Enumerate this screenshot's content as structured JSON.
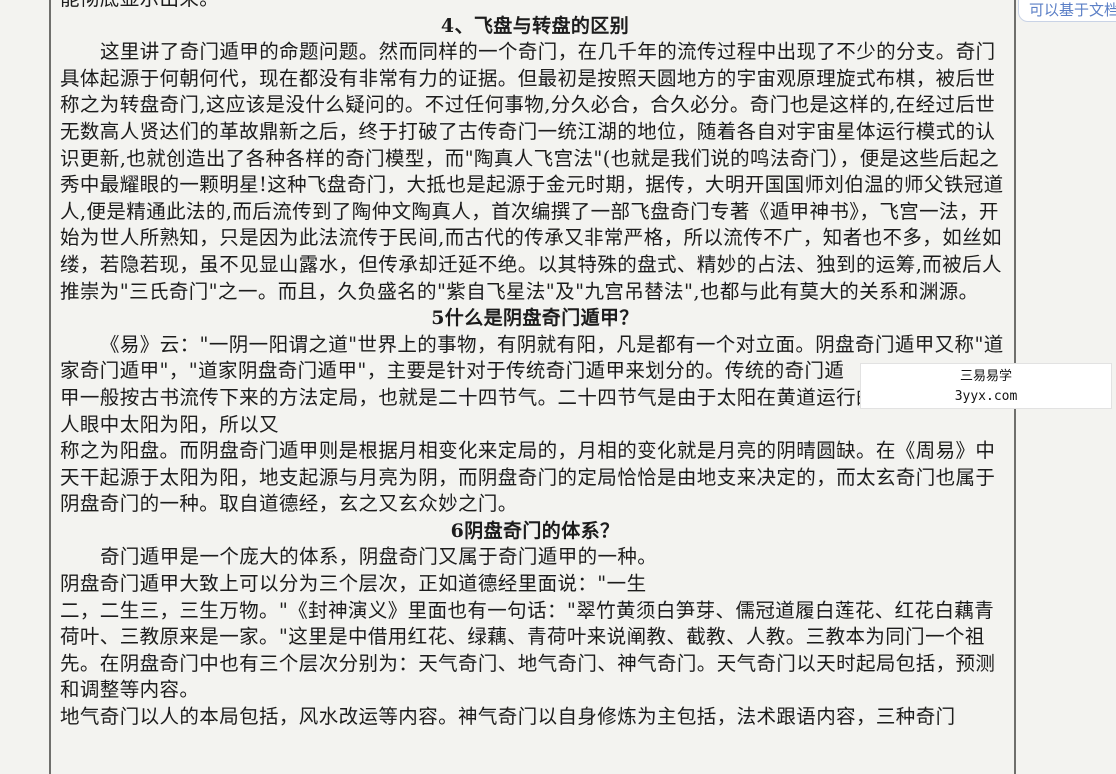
{
  "article": {
    "top_fragment": "能彻底显示出来。",
    "sections": [
      {
        "heading": "4、飞盘与转盘的区别",
        "paragraphs": [
          "这里讲了奇门遁甲的命题问题。然而同样的一个奇门，在几千年的流传过程中出现了不少的分支。奇门具体起源于何朝何代，现在都没有非常有力的证据。但最初是按照天圆地方的宇宙观原理旋式布棋，被后世称之为转盘奇门,这应该是没什么疑问的。不过任何事物,分久必合，合久必分。奇门也是这样的,在经过后世无数高人贤达们的革故鼎新之后，终于打破了古传奇门一统江湖的地位，随着各自对宇宙星体运行模式的认识更新,也就创造出了各种各样的奇门模型，而\"陶真人飞宫法\"(也就是我们说的鸣法奇门），便是这些后起之秀中最耀眼的一颗明星!这种飞盘奇门，大抵也是起源于金元时期，据传，大明开国国师刘伯温的师父铁冠道人,便是精通此法的,而后流传到了陶仲文陶真人，首次编撰了一部飞盘奇门专著《遁甲神书》，飞宫一法，开始为世人所熟知，只是因为此法流传于民间,而古代的传承又非常严格，所以流传不广，知者也不多，如丝如缕，若隐若现，虽不见显山露水，但传承却迁延不绝。以其特殊的盘式、精妙的占法、独到的运筹,而被后人推崇为\"三氏奇门\"之一。而且，久负盛名的\"紫自飞星法\"及\"九宫吊替法\",也都与此有莫大的关系和渊源。"
        ]
      },
      {
        "heading": "5什么是阴盘奇门遁甲？",
        "paragraphs": [
          "《易》云：\"一阴一阳谓之道\"世界上的事物，有阴就有阳，凡是都有一个对立面。阴盘奇门遁甲又称\"道家奇门遁甲\"，\"道家阴盘奇门遁甲\"，主要是针对于传统奇门遁甲来划分的。传统的奇门遁",
          "甲一般按古书流传下来的方法定局，也就是二十四节气。二十四节气是由于太阳在黄道运行的位置而定，古人眼中太阳为阳，所以又",
          "称之为阳盘。而阴盘奇门遁甲则是根据月相变化来定局的，月相的变化就是月亮的阴晴圆缺。在《周易》中天干起源于太阳为阳，地支起源与月亮为阴，而阴盘奇门的定局恰恰是由地支来决定的，而太玄奇门也属于阴盘奇门的一种。取自道德经，玄之又玄众妙之门。"
        ]
      },
      {
        "heading": "6阴盘奇门的体系？",
        "paragraphs": [
          "奇门遁甲是一个庞大的体系，阴盘奇门又属于奇门遁甲的一种。",
          "阴盘奇门遁甲大致上可以分为三个层次，正如道德经里面说：\"一生",
          "二，二生三，三生万物。\"《封神演义》里面也有一句话：\"翠竹黄须白笋芽、儒冠道履白莲花、红花白藕青荷叶、三教原来是一家。\"这里是中借用红花、绿藕、青荷叶来说阐教、截教、人教。三教本为同门一个祖先。在阴盘奇门中也有三个层次分别为：天气奇门、地气奇门、神气奇门。天气奇门以天时起局包括，预测和调整等内容。",
          "地气奇门以人的本局包括，风水改运等内容。神气奇门以自身修炼为主包括，法术跟语内容，三种奇门"
        ]
      }
    ]
  },
  "watermark": {
    "line1": "三易易学",
    "line2": "3yyx.com"
  },
  "corner_tab": "可以基于文档"
}
